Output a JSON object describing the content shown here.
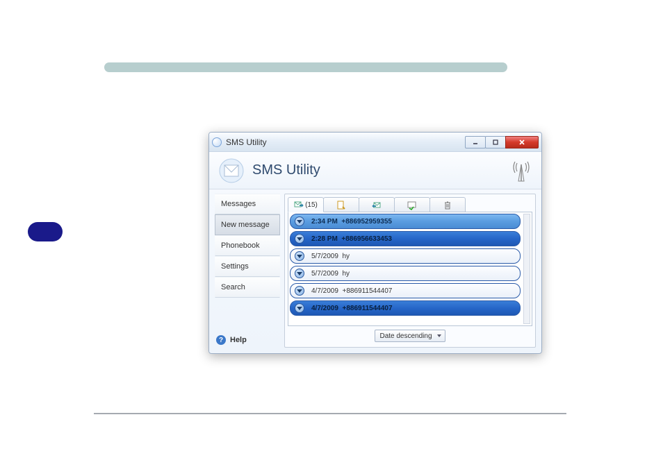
{
  "window": {
    "title": "SMS Utility",
    "app_title": "SMS Utility"
  },
  "sidebar": {
    "items": [
      {
        "label": "Messages"
      },
      {
        "label": "New message"
      },
      {
        "label": "Phonebook"
      },
      {
        "label": "Settings"
      },
      {
        "label": "Search"
      }
    ],
    "help_label": "Help"
  },
  "tabs": {
    "inbox_count": "(15)"
  },
  "messages": [
    {
      "time": "2:34 PM",
      "sender": "+886952959355",
      "style": "selected"
    },
    {
      "time": "2:28 PM",
      "sender": "+886956633453",
      "style": "deep"
    },
    {
      "time": "5/7/2009",
      "sender": "hy",
      "style": "plain"
    },
    {
      "time": "5/7/2009",
      "sender": "hy",
      "style": "plain"
    },
    {
      "time": "4/7/2009",
      "sender": "+886911544407",
      "style": "plain"
    },
    {
      "time": "4/7/2009",
      "sender": "+886911544407",
      "style": "deep"
    }
  ],
  "sort": {
    "selected": "Date descending"
  }
}
